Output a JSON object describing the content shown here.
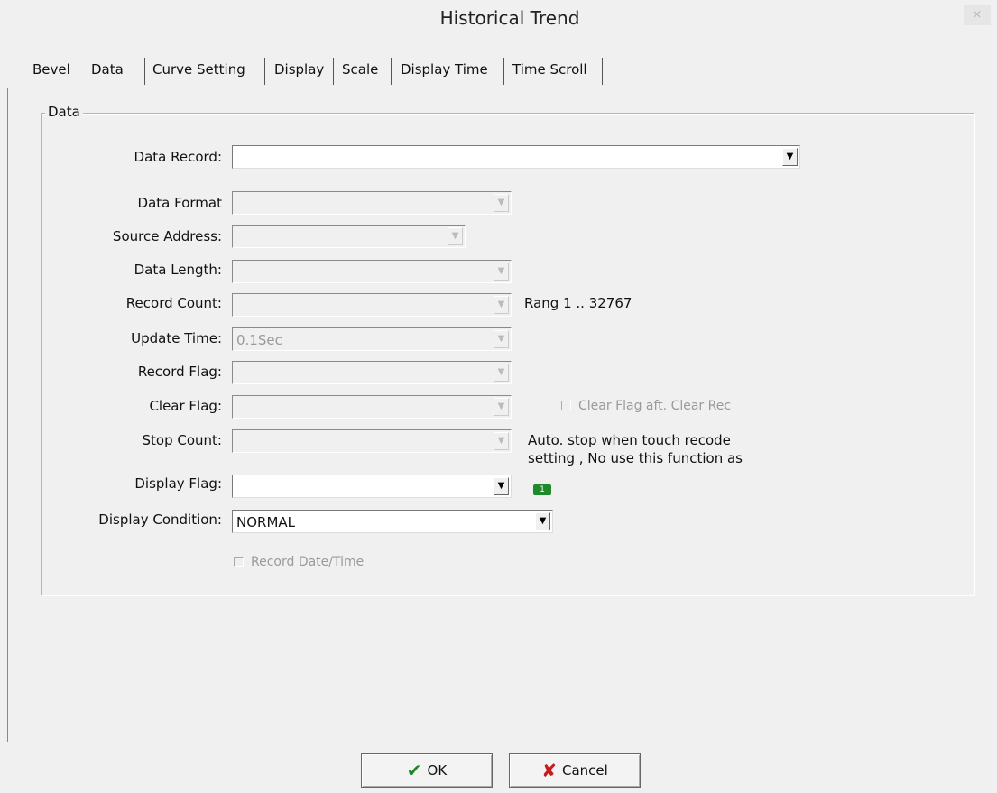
{
  "window": {
    "title": "Historical Trend",
    "close_glyph": "×"
  },
  "tabs": [
    {
      "label": "Bevel"
    },
    {
      "label": "Data",
      "active": true
    },
    {
      "label": "Curve Setting"
    },
    {
      "label": "Display"
    },
    {
      "label": "Scale"
    },
    {
      "label": "Display Time"
    },
    {
      "label": "Time Scroll"
    }
  ],
  "group": {
    "title": "Data"
  },
  "fields": {
    "data_record": {
      "label": "Data Record:",
      "value": ""
    },
    "data_format": {
      "label": "Data Format",
      "value": ""
    },
    "source_address": {
      "label": "Source Address:",
      "value": ""
    },
    "data_length": {
      "label": "Data Length:",
      "value": ""
    },
    "record_count": {
      "label": "Record Count:",
      "value": "",
      "hint": "Rang 1 .. 32767"
    },
    "update_time": {
      "label": "Update Time:",
      "value": "0.1Sec"
    },
    "record_flag": {
      "label": "Record Flag:",
      "value": ""
    },
    "clear_flag": {
      "label": "Clear Flag:",
      "value": "",
      "checkbox": "Clear Flag aft. Clear Rec"
    },
    "stop_count": {
      "label": "Stop Count:",
      "value": "",
      "hint_line1": "Auto. stop when touch recode",
      "hint_line2": "setting , No use this function as"
    },
    "display_flag": {
      "label": "Display Flag:",
      "value": "",
      "badge": "1"
    },
    "display_condition": {
      "label": "Display Condition:",
      "value": "NORMAL"
    }
  },
  "record_datetime": {
    "label": "Record Date/Time",
    "checked": false
  },
  "buttons": {
    "ok": "OK",
    "cancel": "Cancel"
  },
  "icons": {
    "ok": "check-icon",
    "cancel": "x-icon",
    "dropdown": "chevron-down-icon"
  },
  "colors": {
    "ok_icon": "#1d8a26",
    "cancel_icon": "#c8191d",
    "badge": "#1f8a2a"
  }
}
